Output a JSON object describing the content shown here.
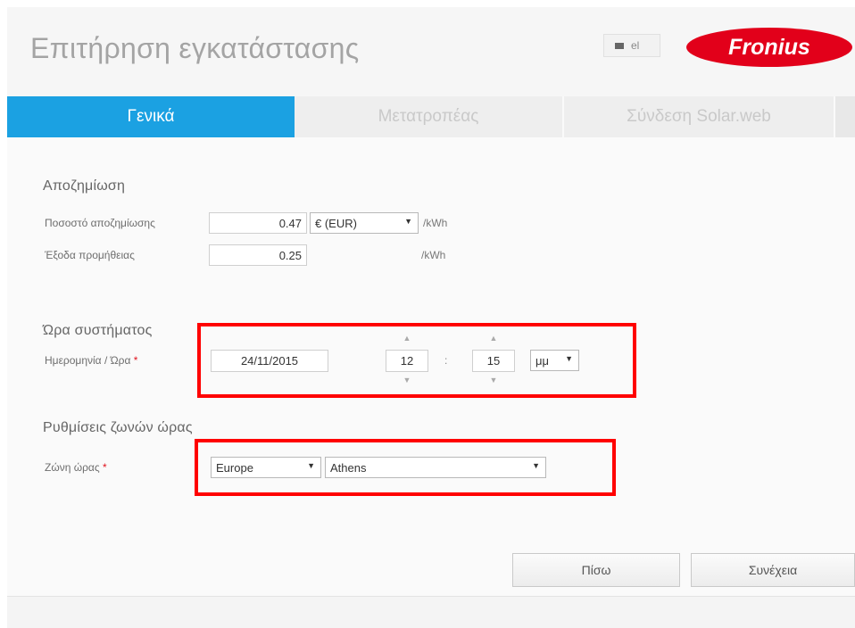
{
  "header": {
    "title": "Επιτήρηση εγκατάστασης",
    "language": "el",
    "logo_text": "Fronius",
    "brand_color": "#e2001a"
  },
  "steps": [
    {
      "label": "Γενικά",
      "active": true
    },
    {
      "label": "Μετατροπέας",
      "active": false
    },
    {
      "label": "Σύνδεση Solar.web",
      "active": false
    }
  ],
  "accent_color": "#1ba1e2",
  "compensation": {
    "title": "Αποζημίωση",
    "rate_label": "Ποσοστό αποζημίωσης",
    "rate_value": "0.47",
    "currency": "€ (EUR)",
    "rate_unit": "/kWh",
    "cost_label": "Έξοδα προμήθειας",
    "cost_value": "0.25",
    "cost_unit": "/kWh"
  },
  "system_time": {
    "title": "Ώρα συστήματος",
    "label": "Ημερομηνία / Ώρα",
    "required_mark": "*",
    "date": "24/11/2015",
    "hour": "12",
    "separator": ":",
    "minute": "15",
    "ampm": "μμ"
  },
  "timezone": {
    "title": "Ρυθμίσεις ζωνών ώρας",
    "label": "Ζώνη ώρας",
    "required_mark": "*",
    "region": "Europe",
    "city": "Athens"
  },
  "buttons": {
    "back": "Πίσω",
    "next": "Συνέχεια"
  }
}
